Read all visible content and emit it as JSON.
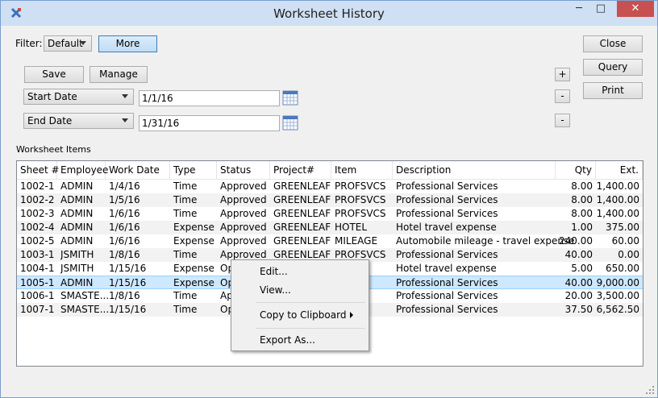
{
  "window": {
    "title": "Worksheet History",
    "minimize": "─",
    "maximize": "□",
    "close": "✕",
    "app_icon": "xtuple-x-icon"
  },
  "filter": {
    "label": "Filter:",
    "value": "Default",
    "more": "More"
  },
  "params": {
    "save": "Save",
    "manage": "Manage",
    "start_field": "Start Date",
    "start_value": "1/1/16",
    "end_field": "End Date",
    "end_value": "1/31/16",
    "add": "+",
    "remove1": "-",
    "remove2": "-"
  },
  "actions": {
    "close": "Close",
    "query": "Query",
    "print": "Print"
  },
  "table": {
    "title": "Worksheet Items",
    "columns": [
      "Sheet #",
      "Employee",
      "Work Date",
      "Type",
      "Status",
      "Project#",
      "Item",
      "Description",
      "Qty",
      "Ext."
    ],
    "rows": [
      [
        "1002-1",
        "ADMIN",
        "1/4/16",
        "Time",
        "Approved",
        "GREENLEAF",
        "PROFSVCS",
        "Professional Services",
        "8.00",
        "1,400.00"
      ],
      [
        "1002-2",
        "ADMIN",
        "1/5/16",
        "Time",
        "Approved",
        "GREENLEAF",
        "PROFSVCS",
        "Professional Services",
        "8.00",
        "1,400.00"
      ],
      [
        "1002-3",
        "ADMIN",
        "1/6/16",
        "Time",
        "Approved",
        "GREENLEAF",
        "PROFSVCS",
        "Professional Services",
        "8.00",
        "1,400.00"
      ],
      [
        "1002-4",
        "ADMIN",
        "1/6/16",
        "Expense",
        "Approved",
        "GREENLEAF",
        "HOTEL",
        "Hotel travel expense",
        "1.00",
        "375.00"
      ],
      [
        "1002-5",
        "ADMIN",
        "1/6/16",
        "Expense",
        "Approved",
        "GREENLEAF",
        "MILEAGE",
        "Automobile mileage - travel expense",
        "240.00",
        "60.00"
      ],
      [
        "1003-1",
        "JSMITH",
        "1/8/16",
        "Time",
        "Approved",
        "GREENLEAF",
        "PROFSVCS",
        "Professional Services",
        "40.00",
        "0.00"
      ],
      [
        "1004-1",
        "JSMITH",
        "1/15/16",
        "Expense",
        "Op",
        "",
        "",
        "Hotel travel expense",
        "5.00",
        "650.00"
      ],
      [
        "1005-1",
        "ADMIN",
        "1/15/16",
        "Expense",
        "Op",
        "",
        "VCS",
        "Professional Services",
        "40.00",
        "9,000.00"
      ],
      [
        "1006-1",
        "SMASTE...",
        "1/8/16",
        "Time",
        "Ap",
        "",
        "VCS",
        "Professional Services",
        "20.00",
        "3,500.00"
      ],
      [
        "1007-1",
        "SMASTE...",
        "1/15/16",
        "Time",
        "Op",
        "",
        "VCS",
        "Professional Services",
        "37.50",
        "6,562.50"
      ]
    ],
    "selected_row": 7
  },
  "context_menu": {
    "edit": "Edit...",
    "view": "View...",
    "copy": "Copy to Clipboard",
    "export": "Export As..."
  }
}
